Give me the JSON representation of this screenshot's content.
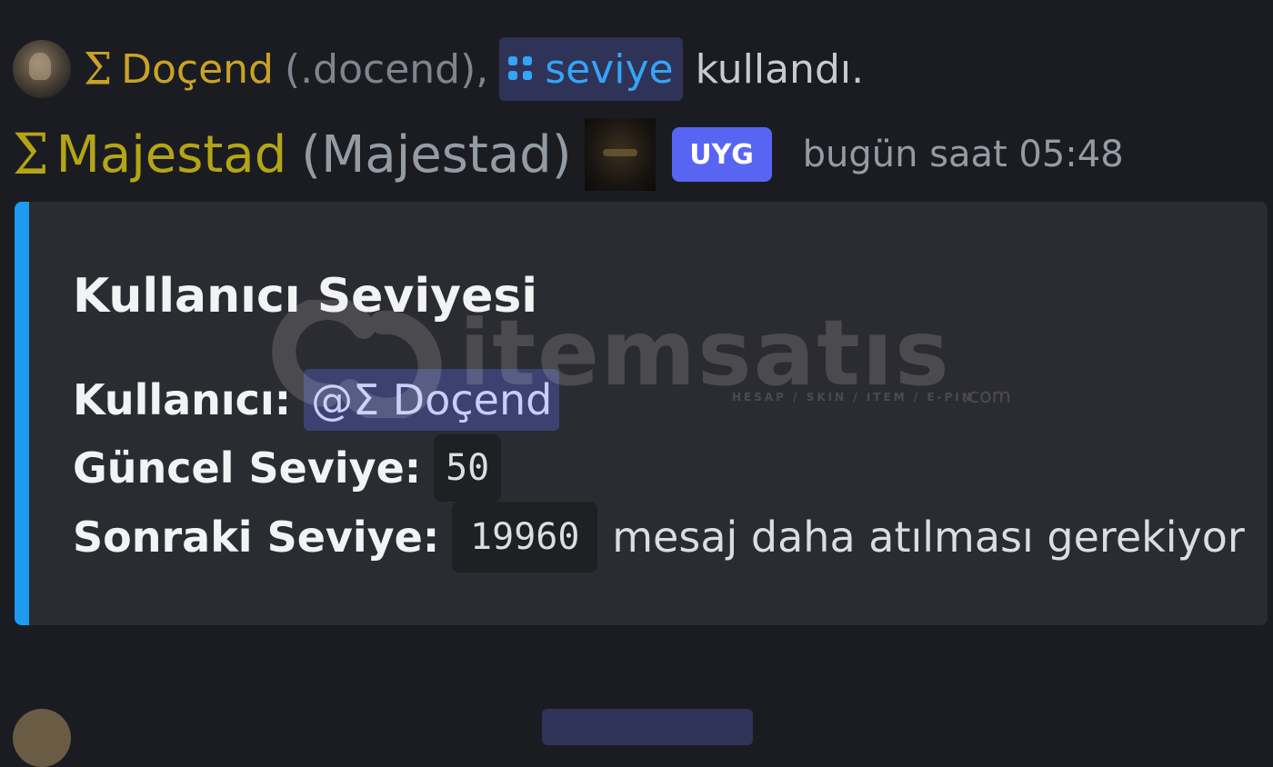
{
  "reply": {
    "sigma": "Σ",
    "name": "Doçend",
    "handle": "(.docend)",
    "comma": ",",
    "command": "seviye",
    "used_text": "kullandı."
  },
  "author": {
    "sigma": "Σ",
    "name": "Majestad",
    "handle": "(Majestad)",
    "app_tag": "UYG",
    "timestamp": "bugün saat 05:48"
  },
  "embed": {
    "accent_color": "#1e9bf0",
    "title": "Kullanıcı Seviyesi",
    "user_label": "Kullanıcı:",
    "user_mention": "@Σ Doçend",
    "level_label": "Güncel Seviye:",
    "level_value": "50",
    "next_label": "Sonraki Seviye:",
    "next_value": "19960",
    "next_suffix": "mesaj daha atılması gerekiyor"
  },
  "watermark": {
    "brand": "itemsatıs",
    "tagline": "HESAP / SKIN / ITEM / E-PIN",
    "domain": ".com"
  },
  "colors": {
    "background": "#1b1c22",
    "embed_background": "#2b2c32",
    "reply_name": "#c9a227",
    "author_name": "#b4a516",
    "command": "#34a4f8",
    "app_tag": "#5865f2"
  },
  "icons": {
    "reply_avatar": "user-avatar",
    "command_app": "app-grid-icon",
    "role": "role-icon"
  }
}
